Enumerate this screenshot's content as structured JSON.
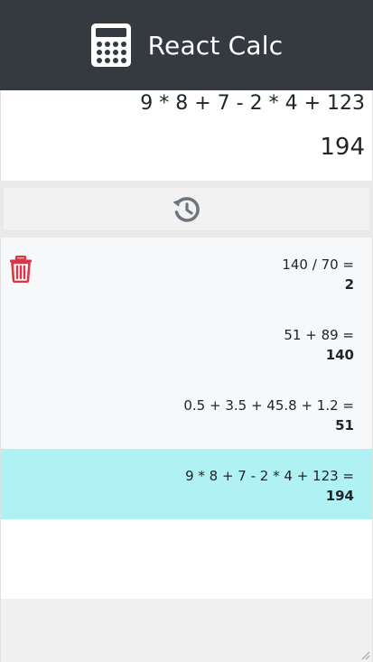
{
  "header": {
    "title": "React Calc",
    "logo_icon": "calculator-icon",
    "background": "#343a40"
  },
  "display": {
    "expression": "9 * 8 + 7 - 2 * 4 + 123",
    "result": "194"
  },
  "history_button": {
    "icon": "history-icon"
  },
  "history": {
    "clear_icon": "trash-icon",
    "entries": [
      {
        "expression": "140 / 70 =",
        "result": "2",
        "active": false
      },
      {
        "expression": "51 + 89 =",
        "result": "140",
        "active": false
      },
      {
        "expression": "0.5 + 3.5 + 45.8 + 1.2 =",
        "result": "51",
        "active": false
      },
      {
        "expression": "9 * 8 + 7 - 2 * 4 + 123 =",
        "result": "194",
        "active": true
      }
    ]
  },
  "colors": {
    "active_entry": "#b0f1f4",
    "trash": "#dc3545",
    "history_icon": "#6c757d"
  }
}
